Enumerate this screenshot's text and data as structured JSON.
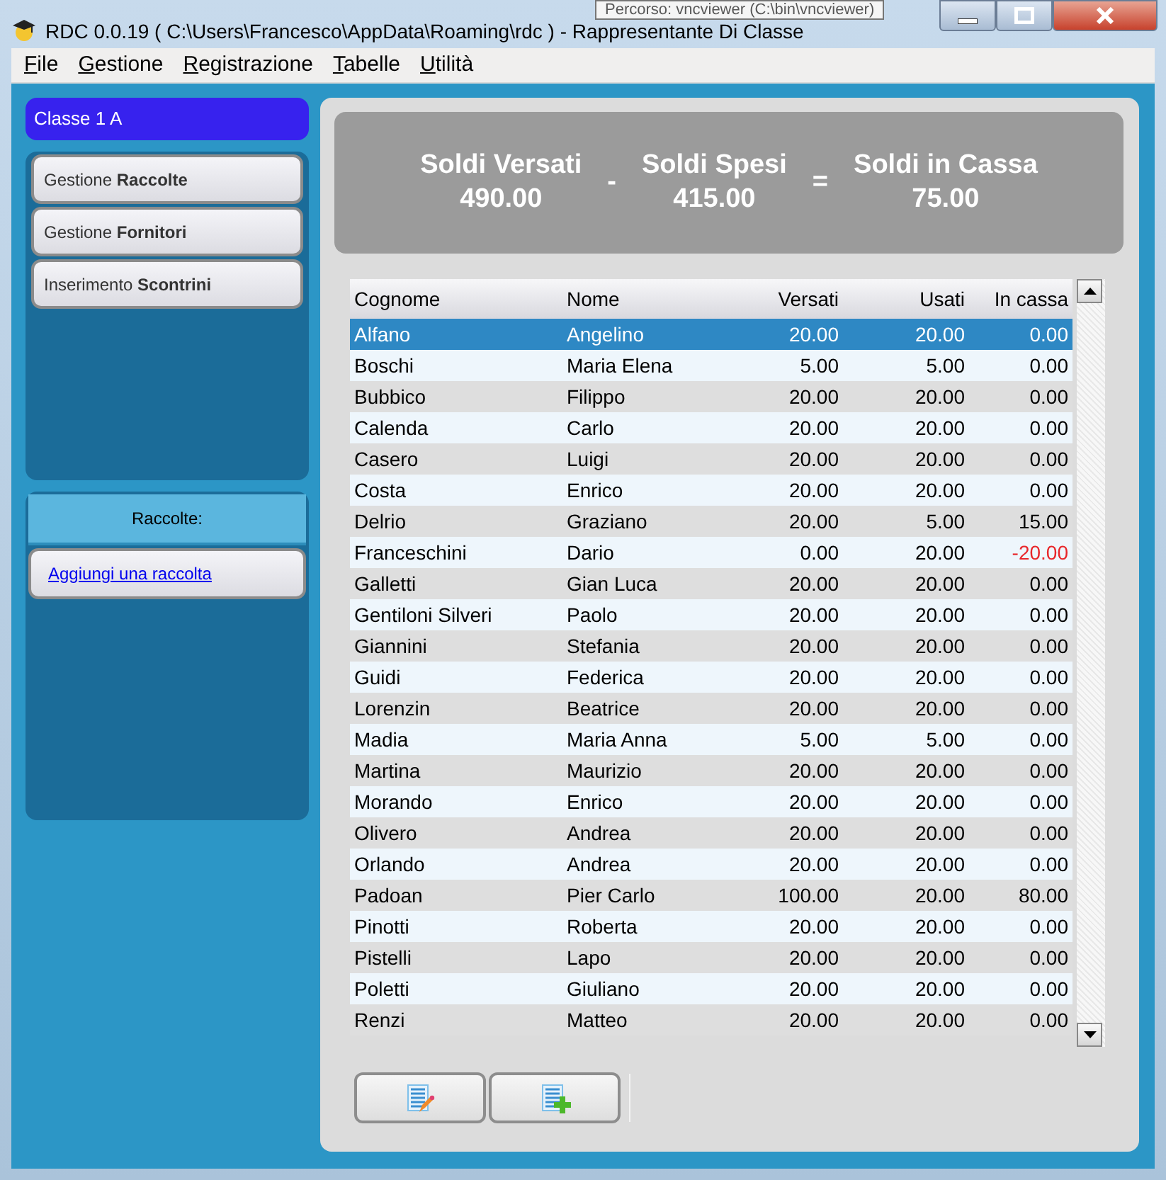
{
  "window": {
    "title": "RDC 0.0.19 ( C:\\Users\\Francesco\\AppData\\Roaming\\rdc ) - Rappresentante Di Classe"
  },
  "tooltip": "Percorso: vncviewer (C:\\bin\\vncviewer)",
  "menu": [
    "File",
    "Gestione",
    "Registrazione",
    "Tabelle",
    "Utilità"
  ],
  "class_label": "Classe 1 A",
  "nav_buttons": [
    {
      "prefix": "Gestione",
      "bold": "Raccolte"
    },
    {
      "prefix": "Gestione",
      "bold": "Fornitori"
    },
    {
      "prefix": "Inserimento",
      "bold": "Scontrini"
    }
  ],
  "raccolte": {
    "header": "Raccolte:",
    "link": "Aggiungi una raccolta"
  },
  "summary": [
    {
      "kind": "value",
      "label": "Soldi Versati",
      "amount": "490.00"
    },
    {
      "kind": "op",
      "symbol": "-"
    },
    {
      "kind": "value",
      "label": "Soldi Spesi",
      "amount": "415.00"
    },
    {
      "kind": "op",
      "symbol": "="
    },
    {
      "kind": "value",
      "label": "Soldi in Cassa",
      "amount": "75.00"
    }
  ],
  "table": {
    "columns": [
      "Cognome",
      "Nome",
      "Versati",
      "Usati",
      "In cassa"
    ],
    "rows": [
      {
        "cells": [
          "Alfano",
          "Angelino",
          "20.00",
          "20.00",
          "0.00"
        ],
        "selected": true,
        "deficit": false
      },
      {
        "cells": [
          "Boschi",
          "Maria Elena",
          "5.00",
          "5.00",
          "0.00"
        ],
        "selected": false,
        "deficit": false
      },
      {
        "cells": [
          "Bubbico",
          "Filippo",
          "20.00",
          "20.00",
          "0.00"
        ],
        "selected": false,
        "deficit": false
      },
      {
        "cells": [
          "Calenda",
          "Carlo",
          "20.00",
          "20.00",
          "0.00"
        ],
        "selected": false,
        "deficit": false
      },
      {
        "cells": [
          "Casero",
          "Luigi",
          "20.00",
          "20.00",
          "0.00"
        ],
        "selected": false,
        "deficit": false
      },
      {
        "cells": [
          "Costa",
          "Enrico",
          "20.00",
          "20.00",
          "0.00"
        ],
        "selected": false,
        "deficit": false
      },
      {
        "cells": [
          "Delrio",
          "Graziano",
          "20.00",
          "5.00",
          "15.00"
        ],
        "selected": false,
        "deficit": false
      },
      {
        "cells": [
          "Franceschini",
          "Dario",
          "0.00",
          "20.00",
          "-20.00"
        ],
        "selected": false,
        "deficit": true
      },
      {
        "cells": [
          "Galletti",
          "Gian Luca",
          "20.00",
          "20.00",
          "0.00"
        ],
        "selected": false,
        "deficit": false
      },
      {
        "cells": [
          "Gentiloni Silveri",
          "Paolo",
          "20.00",
          "20.00",
          "0.00"
        ],
        "selected": false,
        "deficit": false
      },
      {
        "cells": [
          "Giannini",
          "Stefania",
          "20.00",
          "20.00",
          "0.00"
        ],
        "selected": false,
        "deficit": false
      },
      {
        "cells": [
          "Guidi",
          "Federica",
          "20.00",
          "20.00",
          "0.00"
        ],
        "selected": false,
        "deficit": false
      },
      {
        "cells": [
          "Lorenzin",
          "Beatrice",
          "20.00",
          "20.00",
          "0.00"
        ],
        "selected": false,
        "deficit": false
      },
      {
        "cells": [
          "Madia",
          "Maria Anna",
          "5.00",
          "5.00",
          "0.00"
        ],
        "selected": false,
        "deficit": false
      },
      {
        "cells": [
          "Martina",
          "Maurizio",
          "20.00",
          "20.00",
          "0.00"
        ],
        "selected": false,
        "deficit": false
      },
      {
        "cells": [
          "Morando",
          "Enrico",
          "20.00",
          "20.00",
          "0.00"
        ],
        "selected": false,
        "deficit": false
      },
      {
        "cells": [
          "Olivero",
          "Andrea",
          "20.00",
          "20.00",
          "0.00"
        ],
        "selected": false,
        "deficit": false
      },
      {
        "cells": [
          "Orlando",
          "Andrea",
          "20.00",
          "20.00",
          "0.00"
        ],
        "selected": false,
        "deficit": false
      },
      {
        "cells": [
          "Padoan",
          "Pier Carlo",
          "100.00",
          "20.00",
          "80.00"
        ],
        "selected": false,
        "deficit": false
      },
      {
        "cells": [
          "Pinotti",
          "Roberta",
          "20.00",
          "20.00",
          "0.00"
        ],
        "selected": false,
        "deficit": false
      },
      {
        "cells": [
          "Pistelli",
          "Lapo",
          "20.00",
          "20.00",
          "0.00"
        ],
        "selected": false,
        "deficit": false
      },
      {
        "cells": [
          "Poletti",
          "Giuliano",
          "20.00",
          "20.00",
          "0.00"
        ],
        "selected": false,
        "deficit": false
      },
      {
        "cells": [
          "Renzi",
          "Matteo",
          "20.00",
          "20.00",
          "0.00"
        ],
        "selected": false,
        "deficit": false
      }
    ]
  },
  "toolbar": [
    {
      "kind": "edit"
    },
    {
      "kind": "add"
    }
  ]
}
